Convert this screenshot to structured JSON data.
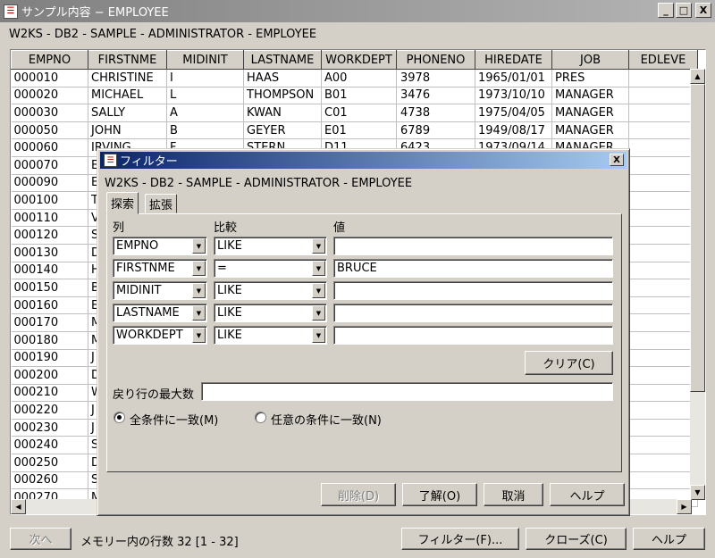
{
  "window": {
    "title": "サンプル内容 − EMPLOYEE",
    "subtitle": "W2KS - DB2 - SAMPLE - ADMINISTRATOR - EMPLOYEE",
    "minimize": "_",
    "maximize": "□",
    "close": "X"
  },
  "table": {
    "columns": [
      "EMPNO",
      "FIRSTNME",
      "MIDINIT",
      "LASTNAME",
      "WORKDEPT",
      "PHONENO",
      "HIREDATE",
      "JOB",
      "EDLEVE"
    ],
    "rows": [
      [
        "000010",
        "CHRISTINE",
        "I",
        "HAAS",
        "A00",
        "3978",
        "1965/01/01",
        "PRES",
        ""
      ],
      [
        "000020",
        "MICHAEL",
        "L",
        "THOMPSON",
        "B01",
        "3476",
        "1973/10/10",
        "MANAGER",
        ""
      ],
      [
        "000030",
        "SALLY",
        "A",
        "KWAN",
        "C01",
        "4738",
        "1975/04/05",
        "MANAGER",
        ""
      ],
      [
        "000050",
        "JOHN",
        "B",
        "GEYER",
        "E01",
        "6789",
        "1949/08/17",
        "MANAGER",
        ""
      ],
      [
        "000060",
        "IRVING",
        "F",
        "STERN",
        "D11",
        "6423",
        "1973/09/14",
        "MANAGER",
        ""
      ],
      [
        "000070",
        "E",
        "",
        "",
        "",
        "",
        "",
        "",
        ""
      ],
      [
        "000090",
        "E",
        "",
        "",
        "",
        "",
        "",
        "",
        ""
      ],
      [
        "000100",
        "T",
        "",
        "",
        "",
        "",
        "",
        "",
        ""
      ],
      [
        "000110",
        "V",
        "",
        "",
        "",
        "",
        "",
        "",
        ""
      ],
      [
        "000120",
        "S",
        "",
        "",
        "",
        "",
        "",
        "",
        ""
      ],
      [
        "000130",
        "D",
        "",
        "",
        "",
        "",
        "",
        "",
        ""
      ],
      [
        "000140",
        "H",
        "",
        "",
        "",
        "",
        "",
        "",
        ""
      ],
      [
        "000150",
        "B",
        "",
        "",
        "",
        "",
        "",
        "",
        ""
      ],
      [
        "000160",
        "E",
        "",
        "",
        "",
        "",
        "",
        "",
        ""
      ],
      [
        "000170",
        "M",
        "",
        "",
        "",
        "",
        "",
        "",
        ""
      ],
      [
        "000180",
        "M",
        "",
        "",
        "",
        "",
        "",
        "",
        ""
      ],
      [
        "000190",
        "J",
        "",
        "",
        "",
        "",
        "",
        "",
        ""
      ],
      [
        "000200",
        "D",
        "",
        "",
        "",
        "",
        "",
        "",
        ""
      ],
      [
        "000210",
        "W",
        "",
        "",
        "",
        "",
        "",
        "",
        ""
      ],
      [
        "000220",
        "J",
        "",
        "",
        "",
        "",
        "",
        "",
        ""
      ],
      [
        "000230",
        "J",
        "",
        "",
        "",
        "",
        "",
        "",
        ""
      ],
      [
        "000240",
        "S",
        "",
        "",
        "",
        "",
        "",
        "",
        ""
      ],
      [
        "000250",
        "D",
        "",
        "",
        "",
        "",
        "",
        "",
        ""
      ],
      [
        "000260",
        "S",
        "",
        "",
        "",
        "",
        "",
        "",
        ""
      ],
      [
        "000270",
        "M",
        "",
        "",
        "",
        "",
        "",
        "",
        ""
      ]
    ]
  },
  "bottom": {
    "next_label": "次へ",
    "status": "メモリー内の行数  32  [1 - 32]",
    "filter_label": "フィルター(F)...",
    "close_label": "クローズ(C)",
    "help_label": "ヘルプ"
  },
  "dialog": {
    "title": "フィルター",
    "close": "X",
    "subtitle": "W2KS - DB2 - SAMPLE - ADMINISTRATOR - EMPLOYEE",
    "tabs": [
      "探索",
      "拡張"
    ],
    "headers": {
      "column": "列",
      "compare": "比較",
      "value": "値"
    },
    "conditions": [
      {
        "column": "EMPNO",
        "op": "LIKE",
        "value": ""
      },
      {
        "column": "FIRSTNME",
        "op": "=",
        "value": "BRUCE"
      },
      {
        "column": "MIDINIT",
        "op": "LIKE",
        "value": ""
      },
      {
        "column": "LASTNAME",
        "op": "LIKE",
        "value": ""
      },
      {
        "column": "WORKDEPT",
        "op": "LIKE",
        "value": ""
      }
    ],
    "clear_label": "クリア(C)",
    "max_rows_label": "戻り行の最大数",
    "max_rows_value": "",
    "match_all_label": "全条件に一致(M)",
    "match_any_label": "任意の条件に一致(N)",
    "delete_label": "削除(D)",
    "ok_label": "了解(O)",
    "cancel_label": "取消",
    "help_label": "ヘルプ"
  }
}
